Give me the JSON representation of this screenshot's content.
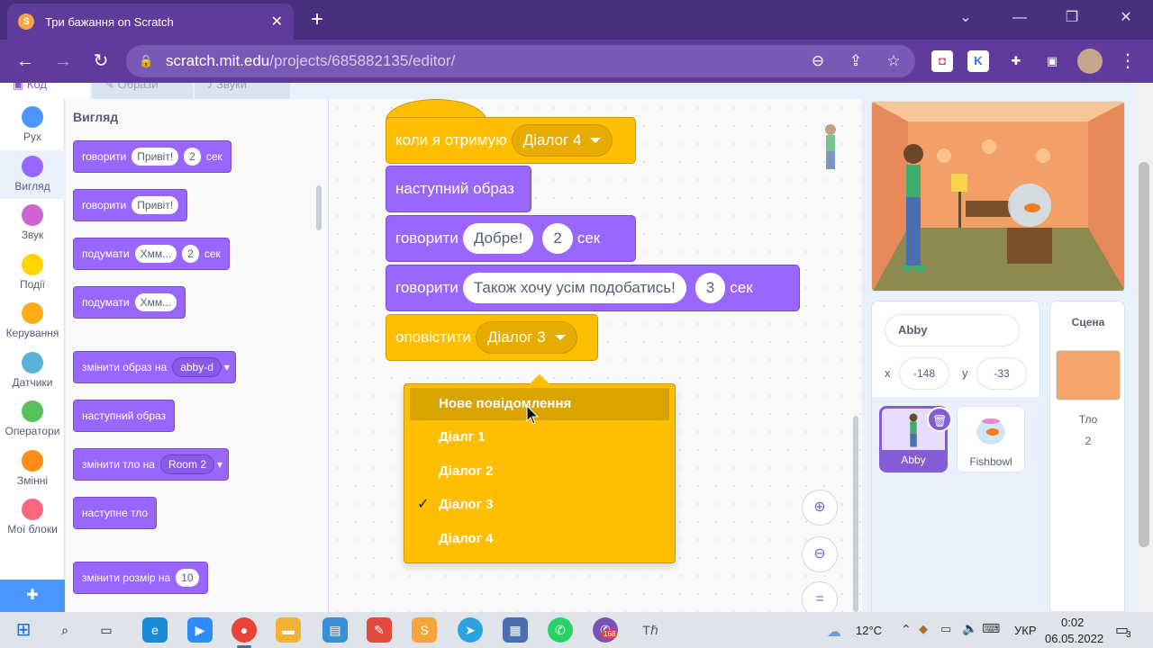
{
  "browser": {
    "tab_title": "Три бажання on Scratch",
    "tab_favicon": "scratch-favicon",
    "url_host": "scratch.mit.edu",
    "url_path": "/projects/685882135/editor/",
    "extensions": [
      {
        "name": "pocket-icon",
        "color": "#e8394a",
        "glyph": "◘"
      },
      {
        "name": "k-extension-icon",
        "color": "#2d6ef0",
        "glyph": "K"
      },
      {
        "name": "puzzle-icon",
        "color": "#ffffff",
        "glyph": "✚"
      },
      {
        "name": "window-icon",
        "color": "#ffffff",
        "glyph": "▣"
      }
    ]
  },
  "editor": {
    "tabs": [
      {
        "label": "Код",
        "icon": "code-icon"
      },
      {
        "label": "Образи",
        "icon": "brush-icon"
      },
      {
        "label": "Звуки",
        "icon": "speaker-icon"
      }
    ]
  },
  "categories": [
    {
      "label": "Рух",
      "color": "#4c97ff"
    },
    {
      "label": "Вигляд",
      "color": "#9966ff"
    },
    {
      "label": "Звук",
      "color": "#cf63cf"
    },
    {
      "label": "Події",
      "color": "#ffd500"
    },
    {
      "label": "Керування",
      "color": "#ffab19"
    },
    {
      "label": "Датчики",
      "color": "#5cb1d6"
    },
    {
      "label": "Оператори",
      "color": "#59c059"
    },
    {
      "label": "Змінні",
      "color": "#ff8c1a"
    },
    {
      "label": "Мої блоки",
      "color": "#ff6680"
    }
  ],
  "palette": {
    "title": "Вигляд",
    "blocks": [
      {
        "parts": [
          {
            "t": "text",
            "v": "говорити"
          },
          {
            "t": "input",
            "v": "Привіт!"
          },
          {
            "t": "input",
            "v": "2"
          },
          {
            "t": "text",
            "v": "сек"
          }
        ]
      },
      {
        "parts": [
          {
            "t": "text",
            "v": "говорити"
          },
          {
            "t": "input",
            "v": "Привіт!"
          }
        ]
      },
      {
        "parts": [
          {
            "t": "text",
            "v": "подумати"
          },
          {
            "t": "input",
            "v": "Хмм..."
          },
          {
            "t": "input",
            "v": "2"
          },
          {
            "t": "text",
            "v": "сек"
          }
        ]
      },
      {
        "parts": [
          {
            "t": "text",
            "v": "подумати"
          },
          {
            "t": "input",
            "v": "Хмм..."
          }
        ]
      },
      {
        "parts": [
          {
            "t": "text",
            "v": "змінити образ на"
          },
          {
            "t": "drop",
            "v": "abby-d"
          }
        ]
      },
      {
        "parts": [
          {
            "t": "text",
            "v": "наступний образ"
          }
        ]
      },
      {
        "parts": [
          {
            "t": "text",
            "v": "змінити тло на"
          },
          {
            "t": "drop",
            "v": "Room 2"
          }
        ]
      },
      {
        "parts": [
          {
            "t": "text",
            "v": "наступне тло"
          }
        ]
      },
      {
        "parts": [
          {
            "t": "text",
            "v": "змінити розмір на"
          },
          {
            "t": "input",
            "v": "10"
          }
        ]
      }
    ]
  },
  "script": {
    "hat_label": "коли я отримую",
    "hat_value": "Діалог 4",
    "next_costume": "наступний образ",
    "say1_label": "говорити",
    "say1_text": "Добре!",
    "say1_secs": "2",
    "say1_unit": "сек",
    "say2_label": "говорити",
    "say2_text": "Також хочу усім подобатись!",
    "say2_secs": "3",
    "say2_unit": "сек",
    "broadcast_label": "оповістити",
    "broadcast_value": "Діалог 3"
  },
  "dropdown": {
    "items": [
      "Нове повідомлення",
      "Діалг 1",
      "Діалог 2",
      "Діалог 3",
      "Діалог 4"
    ],
    "selected_index": 3,
    "hover_index": 0,
    "check": "✓"
  },
  "sprite_info": {
    "name": "Abby",
    "x_label": "x",
    "x_value": "-148",
    "y_label": "y",
    "y_value": "-33"
  },
  "sprites": [
    {
      "name": "Abby",
      "selected": true
    },
    {
      "name": "Fishbowl",
      "selected": false
    }
  ],
  "stage_panel": {
    "title": "Сцена",
    "backdrop_label": "Тло",
    "backdrop_count": "2"
  },
  "taskbar": {
    "temperature": "12°C",
    "language": "УКР",
    "time": "0:02",
    "date": "06.05.2022",
    "notifications": "3",
    "viber_badge": "168"
  }
}
